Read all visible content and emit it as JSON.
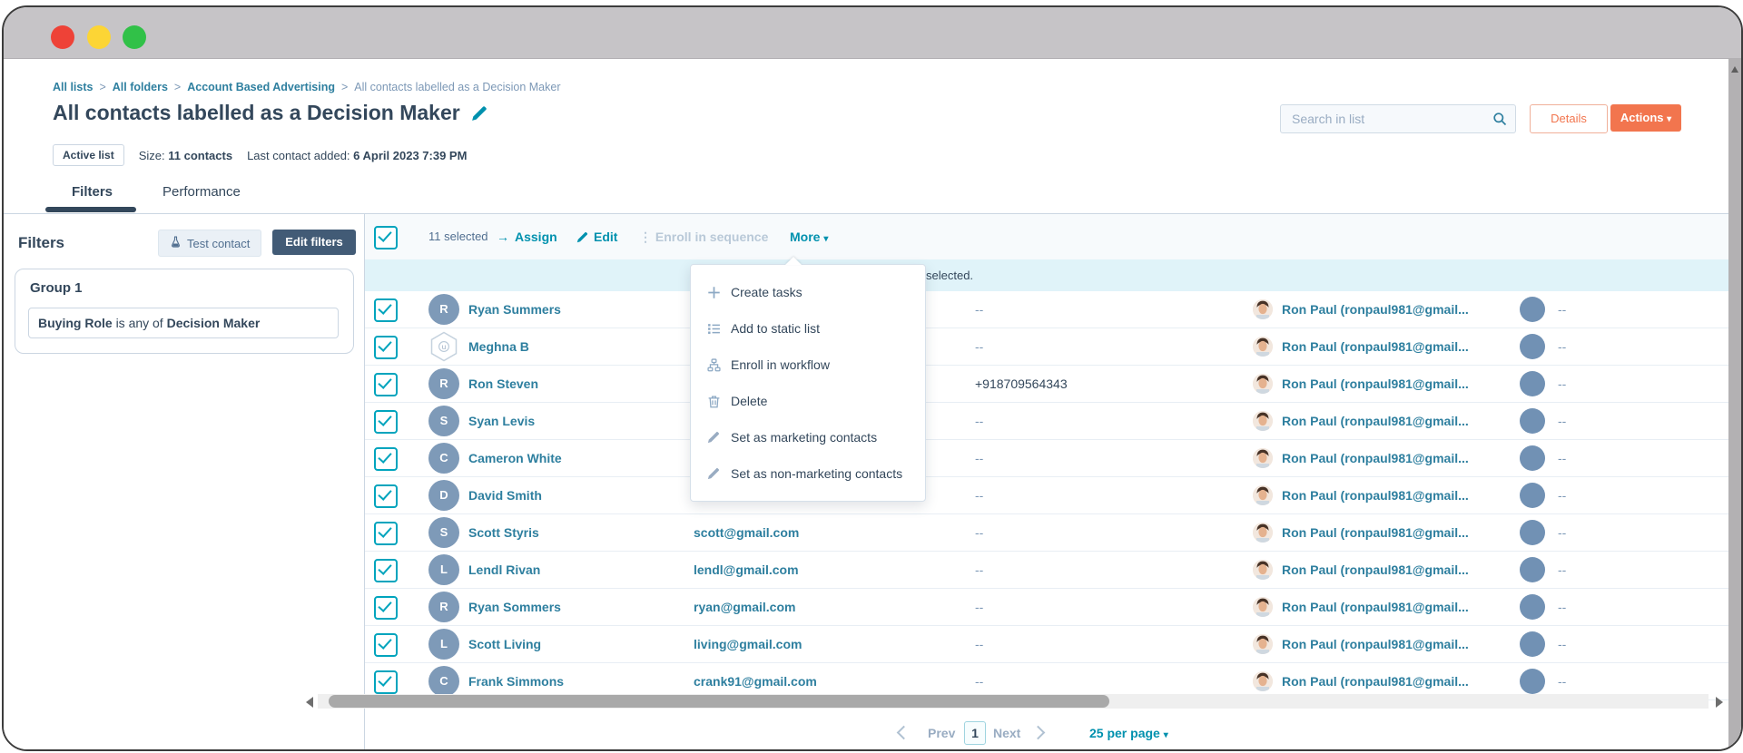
{
  "window": {
    "titlebar_controls": [
      {
        "name": "close",
        "color": "#ee4237"
      },
      {
        "name": "minimize",
        "color": "#fcd535"
      },
      {
        "name": "zoom",
        "color": "#31c148"
      }
    ]
  },
  "breadcrumb": {
    "separator": ">",
    "items": [
      {
        "label": "All lists",
        "link": true
      },
      {
        "label": "All folders",
        "link": true
      },
      {
        "label": "Account Based Advertising",
        "link": true
      },
      {
        "label": "All contacts labelled as a Decision Maker",
        "link": false
      }
    ]
  },
  "header": {
    "title": "All contacts labelled as a Decision Maker",
    "badge": "Active list",
    "size_label": "Size:",
    "size_value": "11 contacts",
    "last_added_label": "Last contact added:",
    "last_added_value": "6 April 2023 7:39 PM",
    "search_placeholder": "Search in list",
    "details_button": "Details",
    "actions_button": "Actions"
  },
  "tabs": [
    {
      "label": "Filters",
      "active": true
    },
    {
      "label": "Performance",
      "active": false
    }
  ],
  "filters_panel": {
    "heading": "Filters",
    "test_contact_button": "Test contact",
    "edit_filters_button": "Edit filters",
    "group_title": "Group 1",
    "condition": {
      "field": "Buying Role",
      "operator": "is any of",
      "value": "Decision Maker"
    }
  },
  "toolbar": {
    "selected_text": "11 selected",
    "assign_label": "Assign",
    "edit_label": "Edit",
    "enroll_label": "Enroll in sequence",
    "more_label": "More"
  },
  "selection_banner": {
    "visible_text_fragment": "selected."
  },
  "more_menu": {
    "items": [
      {
        "icon": "plus-icon",
        "label": "Create tasks"
      },
      {
        "icon": "list-icon",
        "label": "Add to static list"
      },
      {
        "icon": "workflow-icon",
        "label": "Enroll in workflow"
      },
      {
        "icon": "trash-icon",
        "label": "Delete"
      },
      {
        "icon": "pencil-icon",
        "label": "Set as marketing contacts"
      },
      {
        "icon": "pencil-icon",
        "label": "Set as non-marketing contacts"
      }
    ]
  },
  "table": {
    "rows": [
      {
        "checked": true,
        "avatar_letter": "R",
        "avatar_type": "circle",
        "name": "Ryan Summers",
        "email": "",
        "phone": "--",
        "owner": "Ron Paul (ronpaul981@gmail...",
        "secondary_owner": "--"
      },
      {
        "checked": true,
        "avatar_letter": "u",
        "avatar_type": "hexagon",
        "name": "Meghna B",
        "email": "",
        "phone": "--",
        "owner": "Ron Paul (ronpaul981@gmail...",
        "secondary_owner": "--"
      },
      {
        "checked": true,
        "avatar_letter": "R",
        "avatar_type": "circle",
        "name": "Ron Steven",
        "email": "",
        "phone": "+918709564343",
        "owner": "Ron Paul (ronpaul981@gmail...",
        "secondary_owner": "--"
      },
      {
        "checked": true,
        "avatar_letter": "S",
        "avatar_type": "circle",
        "name": "Syan Levis",
        "email": "",
        "phone": "--",
        "owner": "Ron Paul (ronpaul981@gmail...",
        "secondary_owner": "--"
      },
      {
        "checked": true,
        "avatar_letter": "C",
        "avatar_type": "circle",
        "name": "Cameron White",
        "email": "",
        "phone": "--",
        "owner": "Ron Paul (ronpaul981@gmail...",
        "secondary_owner": "--"
      },
      {
        "checked": true,
        "avatar_letter": "D",
        "avatar_type": "circle",
        "name": "David Smith",
        "email": "",
        "phone": "--",
        "owner": "Ron Paul (ronpaul981@gmail...",
        "secondary_owner": "--"
      },
      {
        "checked": true,
        "avatar_letter": "S",
        "avatar_type": "circle",
        "name": "Scott Styris",
        "email": "scott@gmail.com",
        "phone": "--",
        "owner": "Ron Paul (ronpaul981@gmail...",
        "secondary_owner": "--"
      },
      {
        "checked": true,
        "avatar_letter": "L",
        "avatar_type": "circle",
        "name": "Lendl Rivan",
        "email": "lendl@gmail.com",
        "phone": "--",
        "owner": "Ron Paul (ronpaul981@gmail...",
        "secondary_owner": "--"
      },
      {
        "checked": true,
        "avatar_letter": "R",
        "avatar_type": "circle",
        "name": "Ryan Sommers",
        "email": "ryan@gmail.com",
        "phone": "--",
        "owner": "Ron Paul (ronpaul981@gmail...",
        "secondary_owner": "--"
      },
      {
        "checked": true,
        "avatar_letter": "L",
        "avatar_type": "circle",
        "name": "Scott Living",
        "email": "living@gmail.com",
        "phone": "--",
        "owner": "Ron Paul (ronpaul981@gmail...",
        "secondary_owner": "--"
      },
      {
        "checked": true,
        "avatar_letter": "C",
        "avatar_type": "circle",
        "name": "Frank Simmons",
        "email": "crank91@gmail.com",
        "phone": "--",
        "owner": "Ron Paul (ronpaul981@gmail...",
        "secondary_owner": "--"
      }
    ]
  },
  "pagination": {
    "prev_label": "Prev",
    "current_page": "1",
    "next_label": "Next",
    "per_page_label": "25 per page"
  },
  "colors": {
    "accent_orange": "#f2754e",
    "toolbar_link_teal": "#0091ae",
    "row_link_teal": "#2e7f9f",
    "navy_text": "#33475b",
    "checkbox_teal": "#00a4bd",
    "banner_blue": "#e0f3f9",
    "avatar_blue": "#7e9ab8",
    "owner_circle_blue": "#7191b4",
    "titlebar_gray": "#c6c4c7"
  }
}
